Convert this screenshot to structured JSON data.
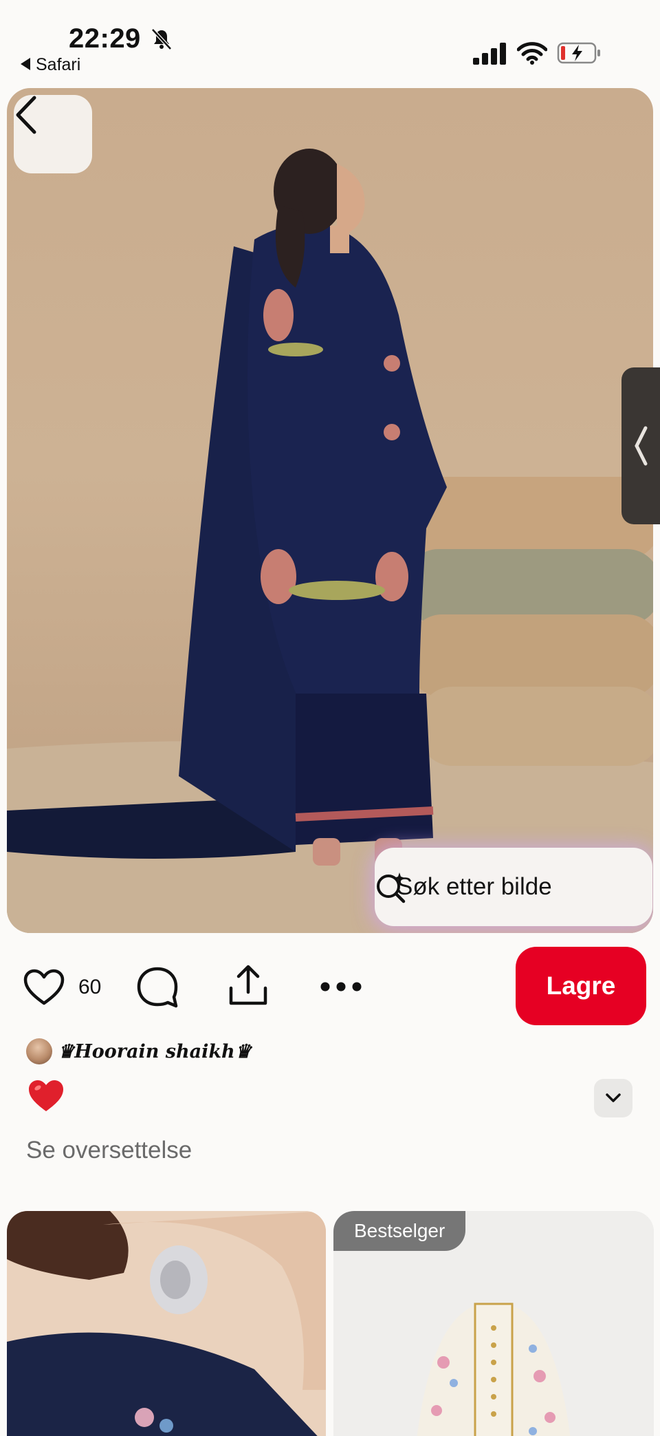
{
  "status_bar": {
    "time": "22:29",
    "back_app": "Safari",
    "icons": [
      "bell-slash-icon",
      "signal-icon",
      "wifi-icon",
      "battery-charging-icon"
    ]
  },
  "hero": {
    "icons": [
      "back-arrow-icon",
      "visual-search-icon",
      "chevron-left-icon"
    ],
    "search_button_label": "Søk etter bilde"
  },
  "actions": {
    "like_count": "60",
    "save_label": "Lagre",
    "icons": [
      "heart-icon",
      "comment-icon",
      "share-icon",
      "more-icon"
    ]
  },
  "author": {
    "name": "♛Hoorain shaikh♛",
    "description_emoji": "❤️",
    "translate_label": "Se oversettelse"
  },
  "grid": {
    "right_badge": "Bestselger"
  },
  "colors": {
    "save_button": "#e60023",
    "background": "#fbfaf8",
    "badge": "#767676"
  }
}
